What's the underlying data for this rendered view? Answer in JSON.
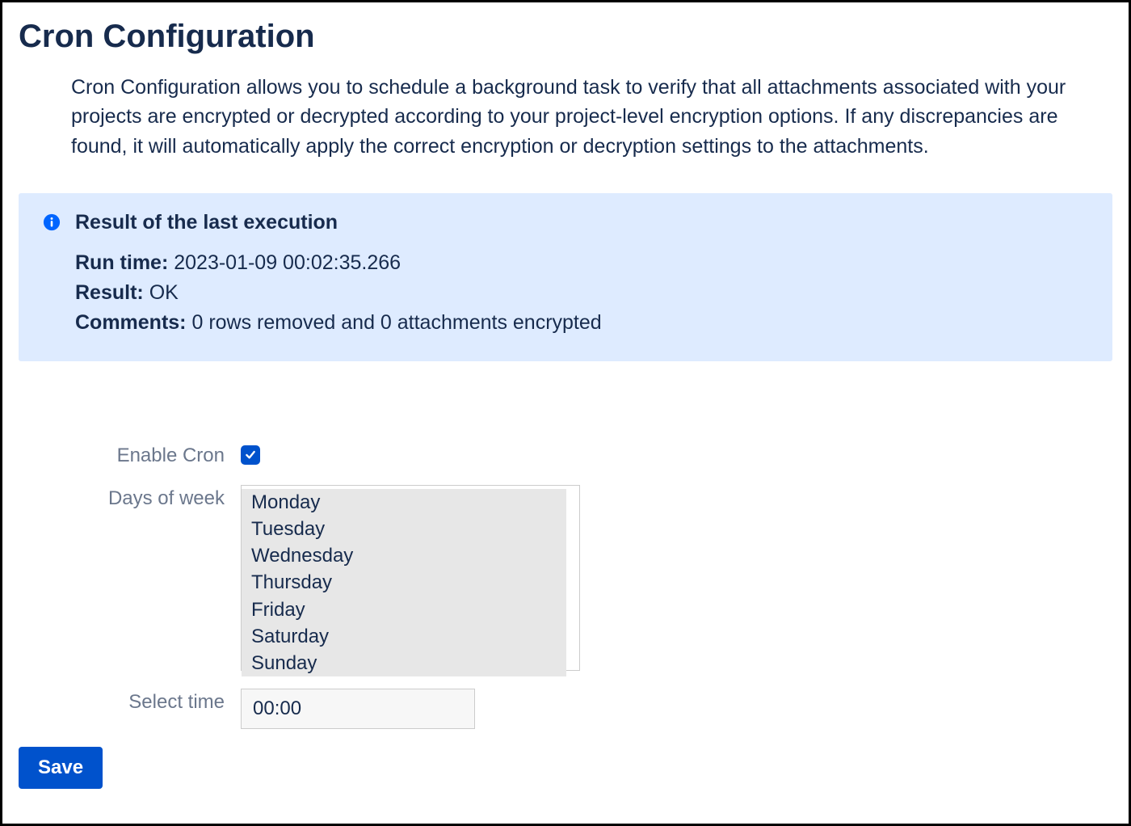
{
  "page": {
    "title": "Cron Configuration",
    "description": "Cron Configuration allows you to schedule a background task to verify that all attachments associated with your projects are encrypted or decrypted according to your project-level encryption options. If any discrepancies are found, it will automatically apply the correct encryption or decryption settings to the attachments."
  },
  "info_panel": {
    "title": "Result of the last execution",
    "runtime_label": "Run time:",
    "runtime_value": "2023-01-09 00:02:35.266",
    "result_label": "Result:",
    "result_value": "OK",
    "comments_label": "Comments:",
    "comments_value": "0 rows removed and 0 attachments encrypted"
  },
  "form": {
    "enable_label": "Enable Cron",
    "enable_checked": true,
    "days_label": "Days of week",
    "days_options": [
      "Monday",
      "Tuesday",
      "Wednesday",
      "Thursday",
      "Friday",
      "Saturday",
      "Sunday"
    ],
    "time_label": "Select time",
    "time_value": "00:00",
    "save_label": "Save"
  }
}
